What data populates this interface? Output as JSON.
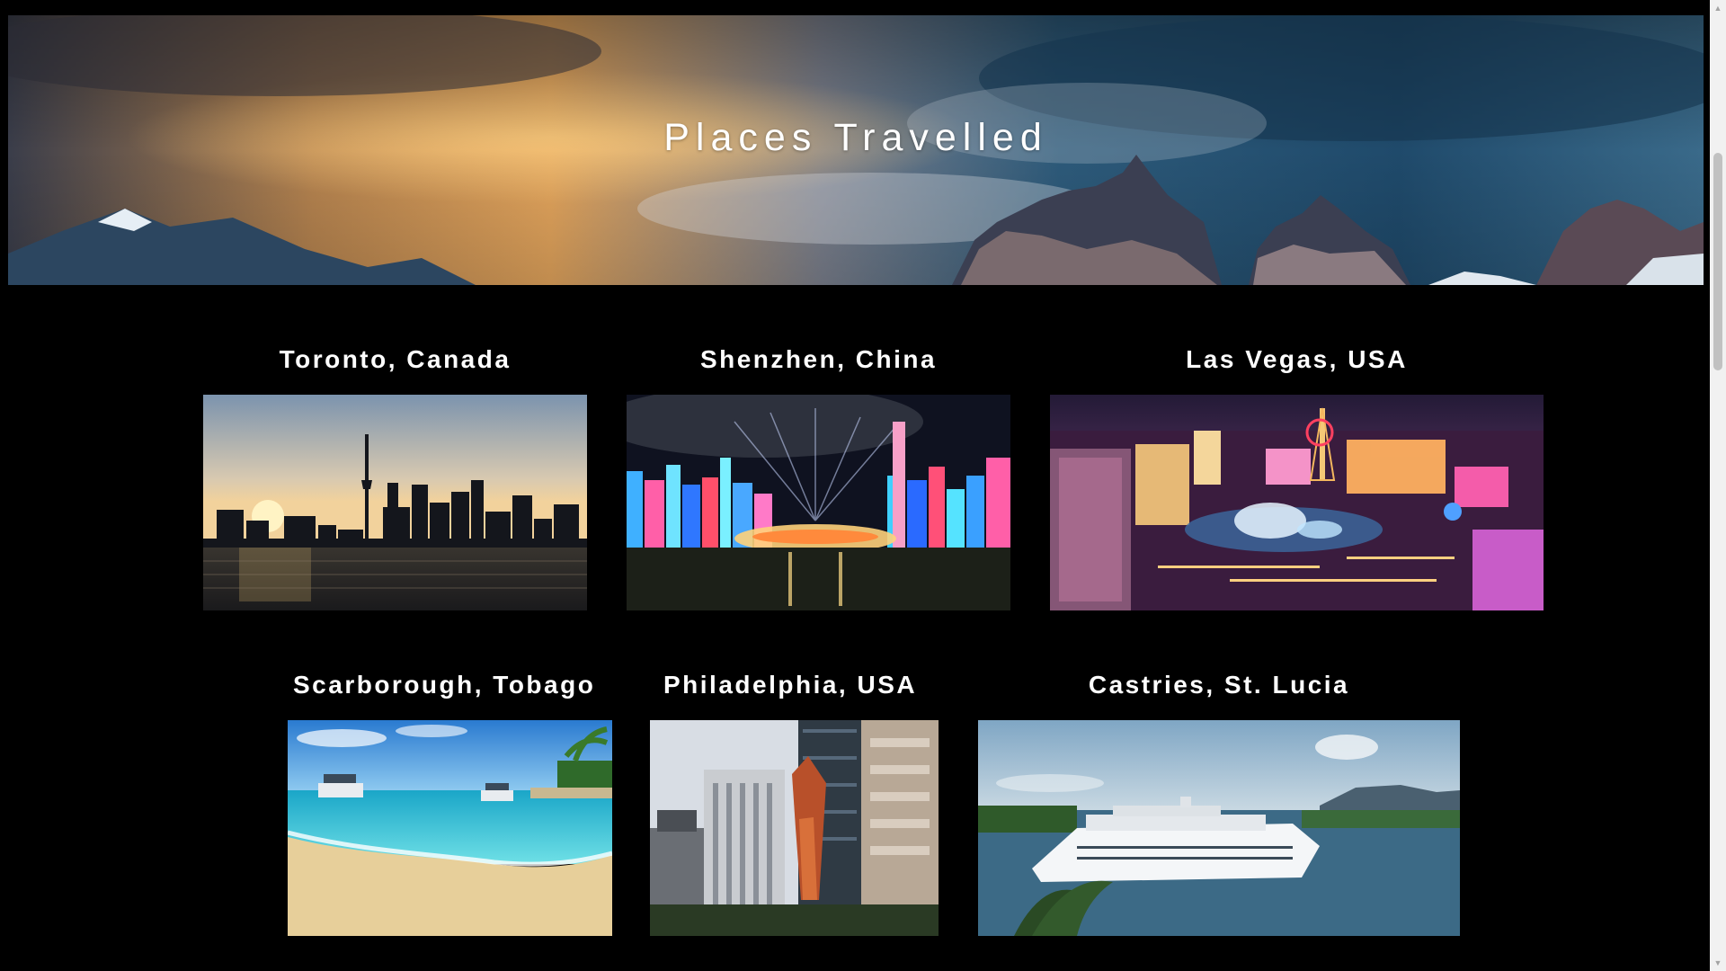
{
  "hero": {
    "title": "Places Travelled"
  },
  "places": [
    {
      "name": "Toronto, Canada",
      "photo": "toronto-skyline"
    },
    {
      "name": "Shenzhen, China",
      "photo": "shenzhen-night-city"
    },
    {
      "name": "Las Vegas, USA",
      "photo": "las-vegas-strip"
    },
    {
      "name": "Scarborough, Tobago",
      "photo": "tobago-beach"
    },
    {
      "name": "Philadelphia, USA",
      "photo": "philadelphia-clothespin"
    },
    {
      "name": "Castries, St. Lucia",
      "photo": "castries-cruise-ship"
    }
  ],
  "colors": {
    "background": "#000000",
    "text": "#ffffff",
    "scrollbar_track": "#f1f1f1",
    "scrollbar_thumb": "#c1c1c1"
  }
}
